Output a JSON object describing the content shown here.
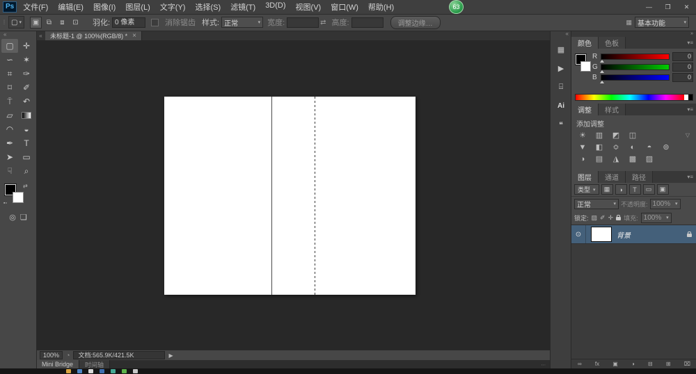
{
  "colors": {
    "ui_bg": "#474747",
    "panel_dark": "#383838",
    "canvas_bg": "#282828",
    "selected_layer": "#44607a",
    "badge_green": "#2e9e4e",
    "logo_blue": "#4fb4f0",
    "canvas_white": "#ffffff"
  },
  "icons": {
    "dropdown_arrow": "▾",
    "swap": "⇄",
    "double_chevron_left": "«",
    "double_chevron_right": "»",
    "panel_menu": "▾≡",
    "close": "×",
    "play": "▶",
    "grip": "⁞",
    "eye": "⊙",
    "minisw": "▪▫",
    "swap_small": "⇄",
    "quick_mask": "◎",
    "screen_mode": "❏",
    "status_profile": "◔",
    "bt_grip": "∙∙∙",
    "tab_scroll": "«"
  },
  "titlebar": {
    "logo": "Ps",
    "menus": [
      "文件(F)",
      "编辑(E)",
      "图像(I)",
      "图层(L)",
      "文字(Y)",
      "选择(S)",
      "滤镜(T)",
      "3D(D)",
      "视图(V)",
      "窗口(W)",
      "帮助(H)"
    ],
    "badge": "63",
    "window_controls": {
      "minimize": "—",
      "restore": "❐",
      "close": "✕"
    }
  },
  "optionsbar": {
    "tool_icon": "▢",
    "selection_modes": [
      "▣",
      "⧉",
      "⧈",
      "⊡"
    ],
    "feather_label": "羽化:",
    "feather_value": "0 像素",
    "antialias_label": "消除锯齿",
    "style_label": "样式:",
    "style_value": "正常",
    "width_label": "宽度:",
    "width_value": "",
    "height_label": "高度:",
    "height_value": "",
    "refine_edge_label": "调整边缘…",
    "workspace_icon": "▦",
    "workspace_label": "基本功能"
  },
  "toolbar": {
    "tools": [
      {
        "name": "rectangular-marquee",
        "glyph": "▢"
      },
      {
        "name": "move",
        "glyph": "✛"
      },
      {
        "name": "lasso",
        "glyph": "∽"
      },
      {
        "name": "magic-wand",
        "glyph": "✶"
      },
      {
        "name": "crop",
        "glyph": "⌗"
      },
      {
        "name": "eyedropper",
        "glyph": "✑"
      },
      {
        "name": "healing-brush",
        "glyph": "⌑"
      },
      {
        "name": "brush",
        "glyph": "✐"
      },
      {
        "name": "clone-stamp",
        "glyph": "⍑"
      },
      {
        "name": "history-brush",
        "glyph": "↶"
      },
      {
        "name": "eraser",
        "glyph": "▱"
      },
      {
        "name": "gradient",
        "glyph": ""
      },
      {
        "name": "blur",
        "glyph": "◠"
      },
      {
        "name": "dodge",
        "glyph": "◒"
      },
      {
        "name": "pen",
        "glyph": "✒"
      },
      {
        "name": "type",
        "glyph": "T"
      },
      {
        "name": "path-selection",
        "glyph": "➤"
      },
      {
        "name": "shape",
        "glyph": "▭"
      },
      {
        "name": "hand",
        "glyph": "☟"
      },
      {
        "name": "zoom",
        "glyph": "⌕"
      }
    ]
  },
  "document": {
    "tab_title": "未标题-1 @ 100%(RGB/8) *"
  },
  "statusbar": {
    "zoom": "100%",
    "doc_info": "文档:565.9K/421.5K"
  },
  "bottom_tabs": {
    "mini_bridge": "Mini Bridge",
    "timeline": "时间轴"
  },
  "dock": {
    "icons": [
      {
        "name": "history-panel",
        "glyph": "▦"
      },
      {
        "name": "actions-panel",
        "glyph": "▶"
      },
      {
        "name": "measurement-panel",
        "glyph": "⌸"
      },
      {
        "name": "illustrator-ai",
        "glyph": "Ai"
      },
      {
        "name": "notes-panel",
        "glyph": "❝"
      }
    ]
  },
  "color_panel": {
    "tabs": [
      "颜色",
      "色板"
    ],
    "channels": [
      {
        "label": "R",
        "value": "0"
      },
      {
        "label": "G",
        "value": "0"
      },
      {
        "label": "B",
        "value": "0"
      }
    ]
  },
  "adjustments_panel": {
    "tabs": [
      "调整",
      "样式"
    ],
    "title": "添加调整",
    "more_icon": "▽",
    "row1": [
      {
        "name": "brightness-contrast",
        "glyph": "☀"
      },
      {
        "name": "levels",
        "glyph": "▥"
      },
      {
        "name": "curves",
        "glyph": "◩"
      },
      {
        "name": "exposure",
        "glyph": "◫"
      }
    ],
    "row2": [
      {
        "name": "vibrance",
        "glyph": "▼"
      },
      {
        "name": "hue-saturation",
        "glyph": "◧"
      },
      {
        "name": "color-balance",
        "glyph": "≎"
      },
      {
        "name": "black-white",
        "glyph": "◐"
      },
      {
        "name": "photo-filter",
        "glyph": "◓"
      },
      {
        "name": "channel-mixer",
        "glyph": "⊚"
      }
    ],
    "row3": [
      {
        "name": "invert",
        "glyph": "◑"
      },
      {
        "name": "posterize",
        "glyph": "▤"
      },
      {
        "name": "threshold",
        "glyph": "◮"
      },
      {
        "name": "gradient-map",
        "glyph": "▩"
      },
      {
        "name": "selective-color",
        "glyph": "▨"
      }
    ]
  },
  "layers_panel": {
    "tabs": [
      "图层",
      "通道",
      "路径"
    ],
    "filter": {
      "kind_label": "类型",
      "icons": [
        {
          "name": "filter-pixel-layers",
          "glyph": "▦"
        },
        {
          "name": "filter-adjustment-layers",
          "glyph": "◑"
        },
        {
          "name": "filter-type-layers",
          "glyph": "T"
        },
        {
          "name": "filter-shape-layers",
          "glyph": "▭"
        },
        {
          "name": "filter-smart-objects",
          "glyph": "▣"
        }
      ]
    },
    "blend_mode": "正常",
    "opacity_label": "不透明度:",
    "opacity_value": "100%",
    "lock_label": "锁定:",
    "lock_icons": [
      {
        "name": "lock-transparency",
        "glyph": "▨"
      },
      {
        "name": "lock-pixels",
        "glyph": "✐"
      },
      {
        "name": "lock-position",
        "glyph": "✛"
      }
    ],
    "fill_label": "填充:",
    "fill_value": "100%",
    "layers": [
      {
        "name": "背景",
        "visible": true,
        "locked": true
      }
    ],
    "bottom_icons": [
      {
        "name": "link-layers",
        "glyph": "∞"
      },
      {
        "name": "layer-style",
        "glyph": "fx"
      },
      {
        "name": "add-layer-mask",
        "glyph": "▣"
      },
      {
        "name": "new-adjustment-layer",
        "glyph": "◑"
      },
      {
        "name": "new-group",
        "glyph": "⊟"
      },
      {
        "name": "new-layer",
        "glyph": "⊞"
      },
      {
        "name": "delete-layer",
        "glyph": "⌧"
      }
    ]
  },
  "taskbar": {
    "items": [
      {
        "name": "taskbar-app-1",
        "style": "background:#d9a441"
      },
      {
        "name": "taskbar-app-2",
        "style": "background:#4f86c6"
      },
      {
        "name": "taskbar-app-3",
        "style": "background:#d9d9d9"
      },
      {
        "name": "taskbar-app-4",
        "style": "background:#3f6fb0"
      },
      {
        "name": "taskbar-app-5",
        "style": "background:#46a894"
      },
      {
        "name": "taskbar-app-6",
        "style": "background:#5cb24a"
      },
      {
        "name": "taskbar-app-7",
        "style": "background:#c8c8c8"
      }
    ]
  }
}
